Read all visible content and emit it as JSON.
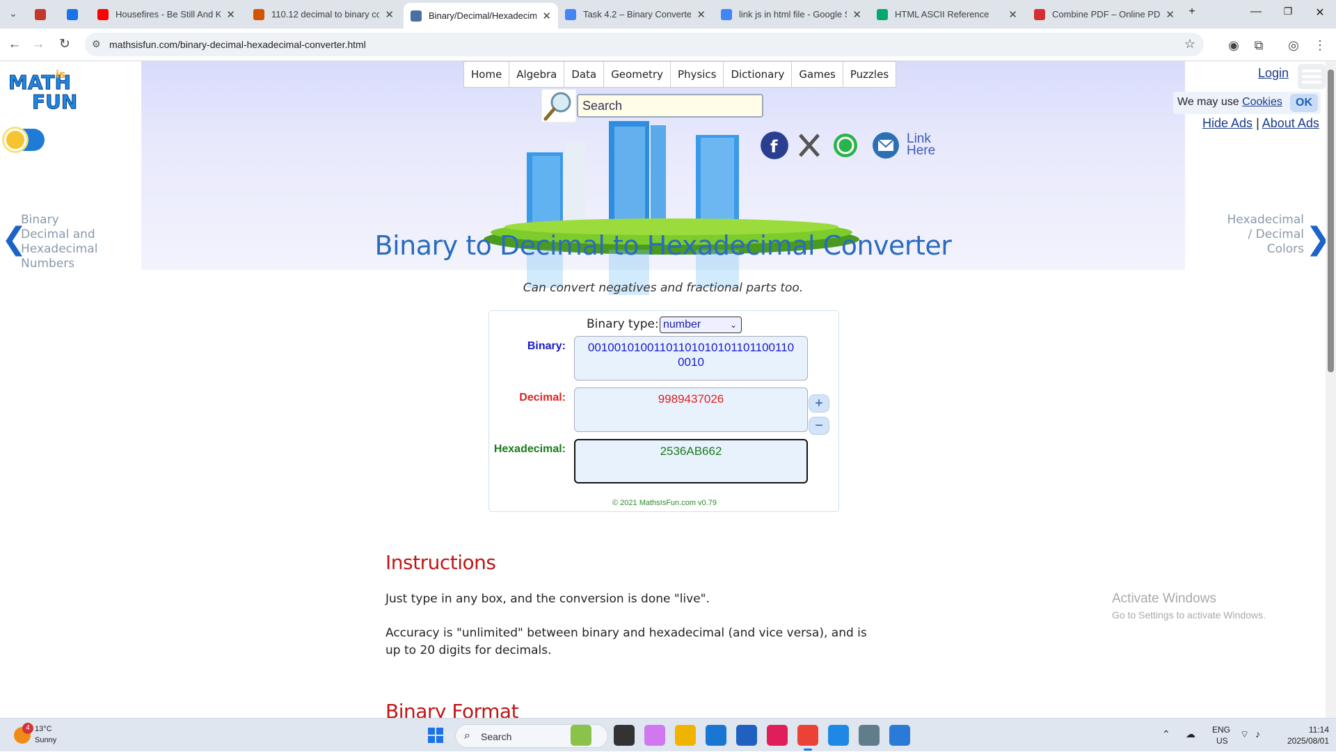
{
  "browser": {
    "tabs": [
      {
        "title": "",
        "favicon": "notebook-icon",
        "color": "#c0392b"
      },
      {
        "title": "",
        "favicon": "sync-icon",
        "color": "#1a73e8"
      },
      {
        "title": "Housefires - Be Still And Kno",
        "favicon": "youtube-icon",
        "color": "#ff0000"
      },
      {
        "title": "110.12 decimal to binary con",
        "favicon": "r-icon",
        "color": "#d35400"
      },
      {
        "title": "Binary/Decimal/Hexadecimal",
        "favicon": "mathsisfun-icon",
        "color": "#4a6fa5"
      },
      {
        "title": "Task 4.2 – Binary Converter &",
        "favicon": "docs-icon",
        "color": "#4285f4"
      },
      {
        "title": "link js in html file - Google S",
        "favicon": "google-icon",
        "color": "#4285f4"
      },
      {
        "title": "HTML ASCII Reference",
        "favicon": "w3schools-icon",
        "color": "#04aa6d"
      },
      {
        "title": "Combine PDF – Online PDF C",
        "favicon": "pdf-icon",
        "color": "#d32f2f"
      }
    ],
    "url": "mathsisfun.com/binary-decimal-hexadecimal-converter.html"
  },
  "site": {
    "nav": [
      "Home",
      "Algebra",
      "Data",
      "Geometry",
      "Physics",
      "Dictionary",
      "Games",
      "Puzzles"
    ],
    "search_placeholder": "Search",
    "login": "Login",
    "cookie_text": "We may use ",
    "cookie_link": "Cookies",
    "ok": "OK",
    "hide_ads": "Hide Ads",
    "sep": "|",
    "about_ads": "About Ads",
    "link_here_1": "Link",
    "link_here_2": "Here",
    "logo_line1": "MATH",
    "logo_is": "is",
    "logo_line2": "FUN",
    "prev_page": [
      "Binary",
      "Decimal and",
      "Hexadecimal",
      "Numbers"
    ],
    "next_page": [
      "Hexadecimal",
      "/ Decimal",
      "Colors"
    ],
    "title": "Binary to Decimal to Hexadecimal Converter",
    "subtitle": "Can convert negatives and fractional parts too."
  },
  "converter": {
    "binary_type_label": "Binary type:",
    "binary_type_value": "number",
    "binary_label": "Binary:",
    "binary_value": "00100101001101101010101101100110\n0010",
    "decimal_label": "Decimal:",
    "decimal_value": "9989437026",
    "hex_label": "Hexadecimal:",
    "hex_value": "2536AB662",
    "plus": "+",
    "minus": "−",
    "copyright": "© 2021 MathsIsFun.com v0.79",
    "colors": {
      "binary": "#1a1acc",
      "decimal": "#e02020",
      "hex": "#1a7a1a"
    }
  },
  "content": {
    "instructions_heading": "Instructions",
    "p1": "Just type in any box, and the conversion is done \"live\".",
    "p2": "Accuracy is \"unlimited\" between binary and hexadecimal (and vice versa), and is up to 20 digits for decimals.",
    "binary_format_heading": "Binary Format"
  },
  "watermark": {
    "line1": "Activate Windows",
    "line2": "Go to Settings to activate Windows."
  },
  "taskbar": {
    "temp": "13°C",
    "condition": "Sunny",
    "weather_badge": "4",
    "search": "Search",
    "lang1": "ENG",
    "lang2": "US",
    "time": "11:14",
    "date": "2025/08/01"
  }
}
